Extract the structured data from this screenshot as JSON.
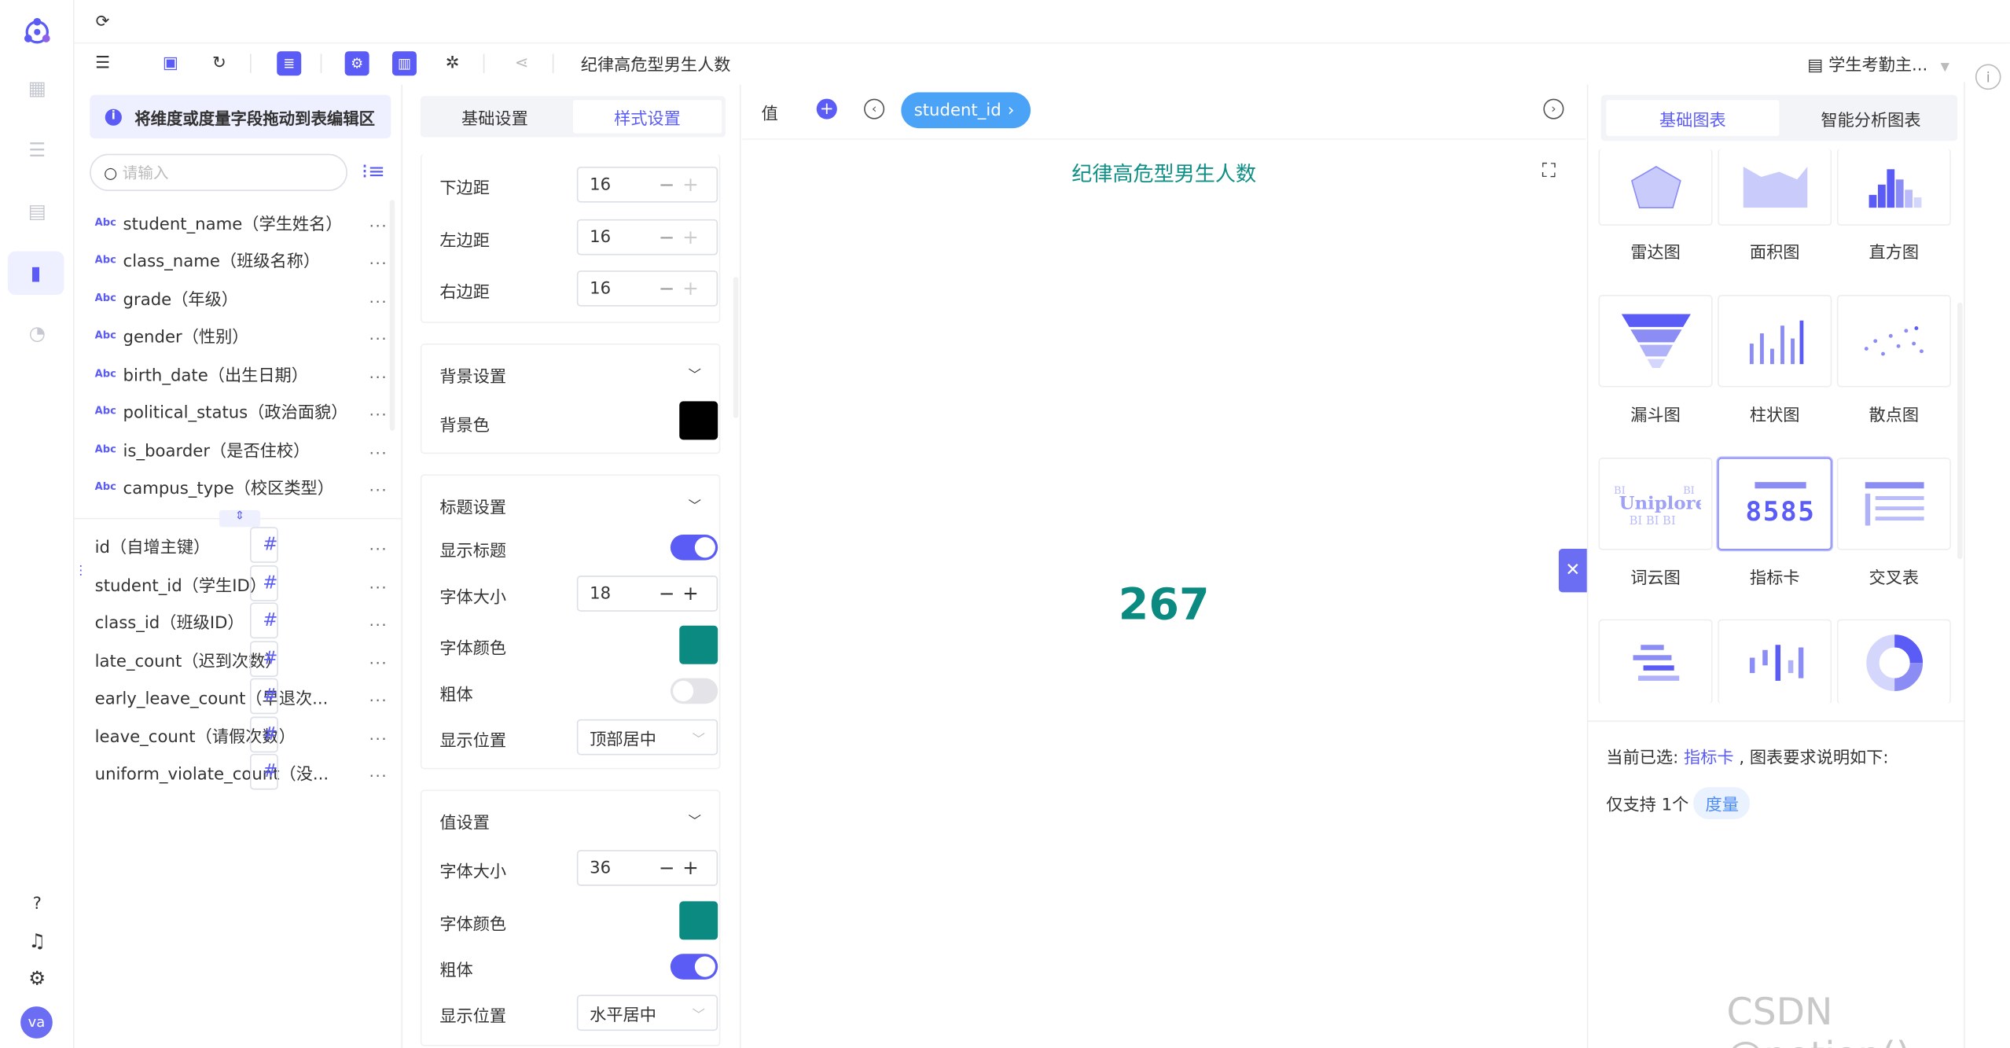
{
  "toolbar": {
    "dataset_title": "纪律高危型男生人数",
    "project": "学生考勤主..."
  },
  "fields_panel": {
    "hint": "将维度或度量字段拖动到表编辑区",
    "search_placeholder": "请输入",
    "dimensions": [
      {
        "type": "Abc",
        "label": "student_name（学生姓名）"
      },
      {
        "type": "Abc",
        "label": "class_name（班级名称）"
      },
      {
        "type": "Abc",
        "label": "grade（年级）"
      },
      {
        "type": "Abc",
        "label": "gender（性别）"
      },
      {
        "type": "Abc",
        "label": "birth_date（出生日期）"
      },
      {
        "type": "Abc",
        "label": "political_status（政治面貌）"
      },
      {
        "type": "Abc",
        "label": "is_boarder（是否住校）"
      },
      {
        "type": "Abc",
        "label": "campus_type（校区类型）"
      }
    ],
    "measures": [
      {
        "type": "#",
        "label": "id（自增主键）"
      },
      {
        "type": "#",
        "label": "student_id（学生ID）"
      },
      {
        "type": "#",
        "label": "class_id（班级ID）"
      },
      {
        "type": "#",
        "label": "late_count（迟到次数）"
      },
      {
        "type": "#",
        "label": "early_leave_count（早退次..."
      },
      {
        "type": "#",
        "label": "leave_count（请假次数）"
      },
      {
        "type": "#",
        "label": "uniform_violate_count（没..."
      }
    ],
    "more": "..."
  },
  "settings_panel": {
    "tabs": [
      "基础设置",
      "样式设置"
    ],
    "margins": [
      {
        "label": "下边距",
        "value": "16"
      },
      {
        "label": "左边距",
        "value": "16"
      },
      {
        "label": "右边距",
        "value": "16"
      }
    ],
    "background": {
      "title": "背景设置",
      "color_label": "背景色",
      "color": "#000000"
    },
    "title_settings": {
      "title": "标题设置",
      "show_label": "显示标题",
      "show": true,
      "font_size_label": "字体大小",
      "font_size": "18",
      "color_label": "字体颜色",
      "color": "#0a8a80",
      "bold_label": "粗体",
      "bold": false,
      "position_label": "显示位置",
      "position": "顶部居中"
    },
    "value_settings": {
      "title": "值设置",
      "font_size_label": "字体大小",
      "font_size": "36",
      "color_label": "字体颜色",
      "color": "#0a8a80",
      "bold_label": "粗体",
      "bold": true,
      "position_label": "显示位置",
      "position": "水平居中"
    }
  },
  "canvas": {
    "value_label": "值",
    "field_pill": "student_id",
    "chart_title": "纪律高危型男生人数",
    "kpi_value": "267"
  },
  "chart_library": {
    "tabs": [
      "基础图表",
      "智能分析图表"
    ],
    "charts": [
      "雷达图",
      "面积图",
      "直方图",
      "漏斗图",
      "柱状图",
      "散点图",
      "词云图",
      "指标卡",
      "交叉表"
    ],
    "kpi_sample": "8585",
    "selected_prefix": "当前已选:",
    "selected": "指标卡",
    "selected_suffix": ", 图表要求说明如下:",
    "requirement": "仅支持 1个",
    "requirement_tag": "度量"
  },
  "user": {
    "avatar": "va"
  },
  "watermark": "CSDN @potion()",
  "accent": "#5b5cf6",
  "teal": "#0a8a80"
}
